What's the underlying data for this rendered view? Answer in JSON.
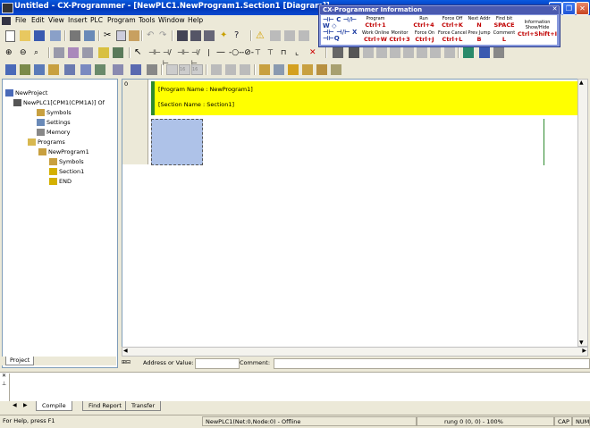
{
  "window": {
    "title": "Untitled - CX-Programmer - [NewPLC1.NewProgram1.Section1 [Diagram]]",
    "minimize": "_",
    "restore": "❐",
    "close": "✕"
  },
  "menu": [
    "File",
    "Edit",
    "View",
    "Insert",
    "PLC",
    "Program",
    "Tools",
    "Window",
    "Help"
  ],
  "info_palette": {
    "title": "CX-Programmer Information",
    "close": "✕",
    "shortcuts": [
      {
        "label": "Program",
        "key": "Ctrl+1"
      },
      {
        "label": "Run",
        "key": "Ctrl+4"
      },
      {
        "label": "Force Off",
        "key": "Ctrl+K"
      },
      {
        "label": "Next Addr",
        "key": "N"
      },
      {
        "label": "Find bit",
        "key": "SPACE"
      },
      {
        "label": "Work Online",
        "key": "Ctrl+W"
      },
      {
        "label": "Monitor",
        "key": "Ctrl+3"
      },
      {
        "label": "Force On",
        "key": "Ctrl+J"
      },
      {
        "label": "Force Cancel",
        "key": "Ctrl+L"
      },
      {
        "label": "Prev Jump",
        "key": "B"
      },
      {
        "label": "Comment",
        "key": "L"
      }
    ],
    "info_toggle": {
      "label": "Information Show/Hide",
      "key": "Ctrl+Shift+I"
    }
  },
  "project_tree": {
    "items": [
      {
        "label": "NewProject",
        "icon": "project-icon"
      },
      {
        "label": "NewPLC1[CPM1(CPM1A)] Of",
        "icon": "plc-icon"
      },
      {
        "label": "Symbols",
        "icon": "symbols-icon"
      },
      {
        "label": "Settings",
        "icon": "settings-icon"
      },
      {
        "label": "Memory",
        "icon": "memory-icon"
      },
      {
        "label": "Programs",
        "icon": "folder-icon"
      },
      {
        "label": "NewProgram1",
        "icon": "program-icon"
      },
      {
        "label": "Symbols",
        "icon": "symbols-icon"
      },
      {
        "label": "Section1",
        "icon": "section-icon"
      },
      {
        "label": "END",
        "icon": "end-icon"
      }
    ],
    "tab": "Project"
  },
  "diagram": {
    "rung_number": "0",
    "program_name": "[Program Name : NewProgram1]",
    "section_name": "[Section Name : Section1]"
  },
  "address_bar": {
    "address_label": "Address or Value:",
    "comment_label": "Comment:"
  },
  "output_tabs": [
    "Compile",
    "Find Report",
    "Transfer"
  ],
  "status_bar": {
    "help": "For Help, press F1",
    "connection": "NewPLC1(Net:0,Node:0) - Offline",
    "rung": "rung 0 (0, 0)  - 100%",
    "cap": "CAP",
    "num": "NUM"
  },
  "colors": {
    "title_bar": "#0a5adf",
    "header_yellow": "#ffff00",
    "header_marker": "#2e8b2e",
    "selection": "#aec2e8",
    "shortcut_key": "#c00000"
  }
}
